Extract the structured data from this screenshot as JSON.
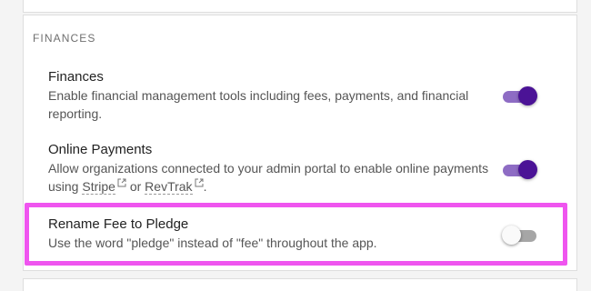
{
  "section": {
    "title": "FINANCES"
  },
  "settings": [
    {
      "title": "Finances",
      "description": "Enable financial management tools including fees, payments, and financial reporting.",
      "enabled": true
    },
    {
      "title": "Online Payments",
      "description_prefix": "Allow organizations connected to your admin portal to enable online payments using ",
      "link1": "Stripe",
      "connector": " or ",
      "link2": "RevTrak",
      "description_suffix": ".",
      "enabled": true
    },
    {
      "title": "Rename Fee to Pledge",
      "description": "Use the word \"pledge\" instead of \"fee\" throughout the app.",
      "enabled": false
    }
  ],
  "colors": {
    "toggle_on_thumb": "#4b1396",
    "toggle_on_track": "#8e6cc4",
    "highlight": "#ef55ef"
  },
  "icons": {
    "external_link": "external-link-icon"
  }
}
